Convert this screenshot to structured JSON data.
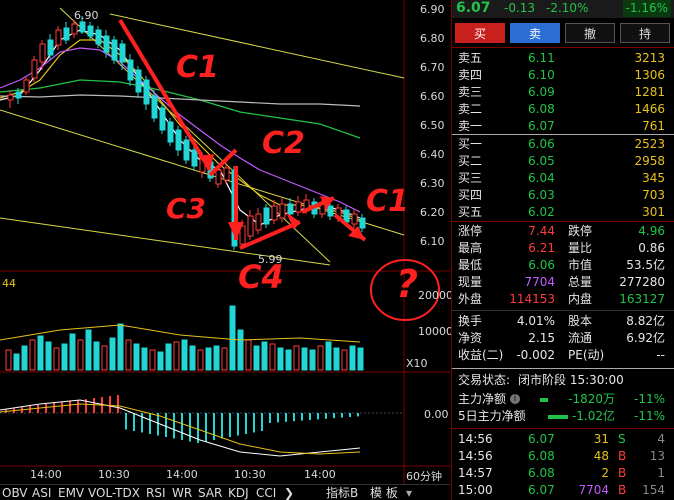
{
  "header": {
    "price": "6.07",
    "change": "-0.13",
    "change_pct": "-2.10%",
    "right_pct": "-1.16%"
  },
  "chart": {
    "high_label": "6.90",
    "low_label": "5.99",
    "left_price_axis_top": "44",
    "price_axis": [
      "6.90",
      "6.80",
      "6.70",
      "6.60",
      "6.50",
      "6.40",
      "6.30",
      "6.20",
      "6.10"
    ],
    "vol_axis": [
      "20000",
      "10000"
    ],
    "vol_unit": "X10",
    "macd_zero": "0.00",
    "time_axis": [
      "14:00",
      "10:30",
      "14:00",
      "10:30",
      "14:00"
    ],
    "period": "60分钟",
    "annotations": [
      "C1",
      "C2",
      "C3",
      "C4",
      "C1",
      "?"
    ],
    "colors": {
      "up": "#ff3a3a",
      "down": "#22d6d6",
      "ma5": "#ffffff",
      "ma10": "#e6c21a",
      "ma20": "#c25bff",
      "ma60": "#22c34a",
      "annot": "#ff2020"
    }
  },
  "trade_buttons": {
    "buy": "买",
    "sell": "卖",
    "cancel": "撤",
    "hold": "持"
  },
  "order_book": {
    "asks": [
      {
        "label": "卖五",
        "price": "6.11",
        "vol": "3213"
      },
      {
        "label": "卖四",
        "price": "6.10",
        "vol": "1306"
      },
      {
        "label": "卖三",
        "price": "6.09",
        "vol": "1281"
      },
      {
        "label": "卖二",
        "price": "6.08",
        "vol": "1466"
      },
      {
        "label": "卖一",
        "price": "6.07",
        "vol": "761"
      }
    ],
    "bids": [
      {
        "label": "买一",
        "price": "6.06",
        "vol": "2523"
      },
      {
        "label": "买二",
        "price": "6.05",
        "vol": "2958"
      },
      {
        "label": "买三",
        "price": "6.04",
        "vol": "345"
      },
      {
        "label": "买四",
        "price": "6.03",
        "vol": "703"
      },
      {
        "label": "买五",
        "price": "6.02",
        "vol": "301"
      }
    ]
  },
  "stats": [
    {
      "l1": "涨停",
      "v1": "7.44",
      "l2": "跌停",
      "v2": "4.96"
    },
    {
      "l1": "最高",
      "v1": "6.21",
      "l2": "量比",
      "v2": "0.86"
    },
    {
      "l1": "最低",
      "v1": "6.06",
      "l2": "市值",
      "v2": "53.5亿"
    },
    {
      "l1": "现量",
      "v1": "7704",
      "l2": "总量",
      "v2": "277280"
    },
    {
      "l1": "外盘",
      "v1": "114153",
      "l2": "内盘",
      "v2": "163127"
    }
  ],
  "stats2": [
    {
      "l1": "换手",
      "v1": "4.01%",
      "l2": "股本",
      "v2": "8.82亿"
    },
    {
      "l1": "净资",
      "v1": "2.15",
      "l2": "流通",
      "v2": "6.92亿"
    },
    {
      "l1": "收益(二)",
      "v1": "-0.002",
      "l2": "PE(动)",
      "v2": "--"
    }
  ],
  "status": {
    "label": "交易状态:",
    "value": "闭市阶段 15:30:00"
  },
  "fund_flow": [
    {
      "label": "主力净额",
      "value": "-1820万",
      "pct": "-11%"
    },
    {
      "label": "5日主力净额",
      "value": "-1.02亿",
      "pct": "-11%"
    }
  ],
  "ticks": [
    {
      "time": "14:56",
      "price": "6.07",
      "vol": "31",
      "side": "S",
      "n": "4"
    },
    {
      "time": "14:56",
      "price": "6.08",
      "vol": "48",
      "side": "B",
      "n": "13"
    },
    {
      "time": "14:57",
      "price": "6.08",
      "vol": "2",
      "side": "B",
      "n": "1"
    },
    {
      "time": "15:00",
      "price": "6.07",
      "vol": "7704",
      "side": "B",
      "n": "154"
    }
  ],
  "indicator_tabs": [
    "OBV",
    "ASI",
    "EMV",
    "VOL-TDX",
    "RSI",
    "WR",
    "SAR",
    "KDJ",
    "CCI"
  ],
  "indicator_more": "指标B",
  "template_tab": "模 板"
}
